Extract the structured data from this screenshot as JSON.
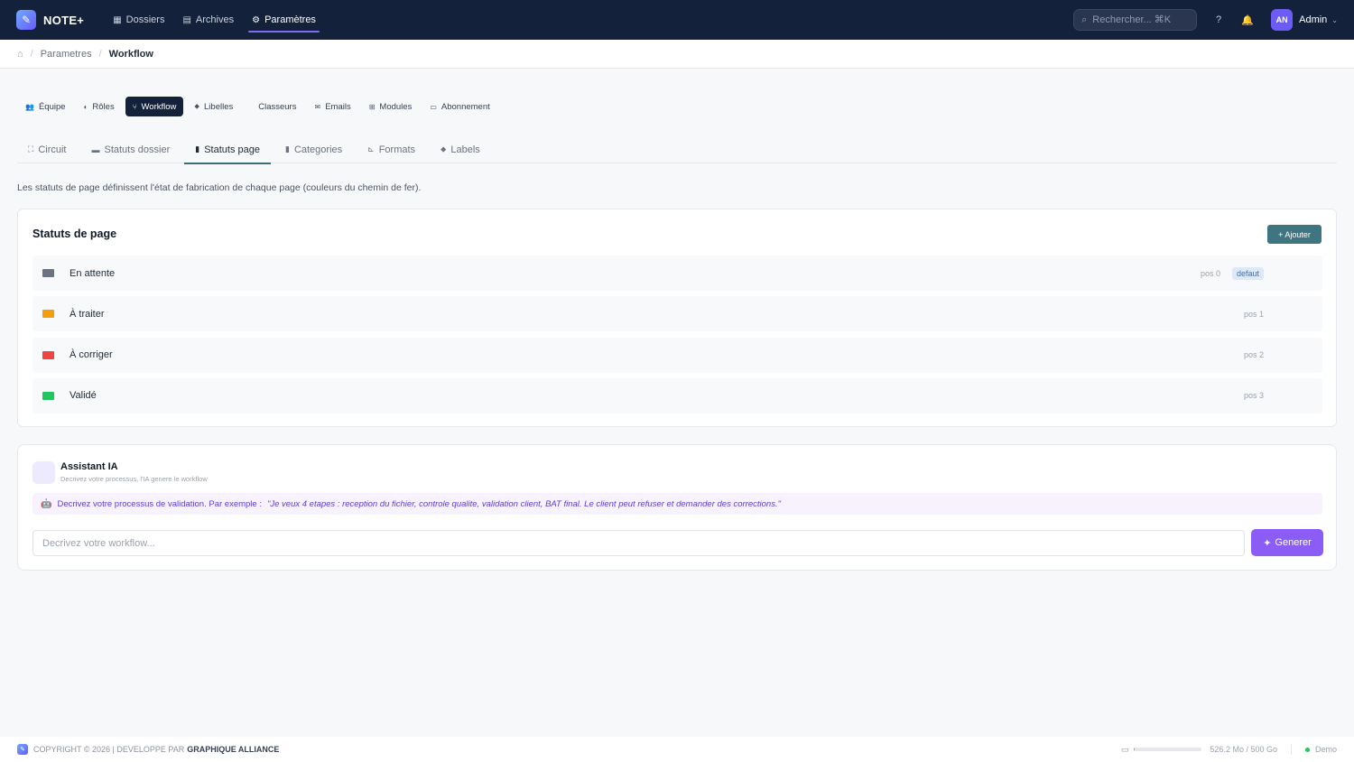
{
  "app": {
    "name": "NOTE+"
  },
  "nav": [
    {
      "label": "Dossiers",
      "icon": "grid-icon",
      "active": false
    },
    {
      "label": "Archives",
      "icon": "archive-icon",
      "active": false
    },
    {
      "label": "Paramètres",
      "icon": "gear-icon",
      "active": true
    }
  ],
  "search": {
    "placeholder": "Rechercher... ⌘K"
  },
  "user": {
    "initials": "AN",
    "name": "Admin"
  },
  "breadcrumb": {
    "parent": "Parametres",
    "current": "Workflow"
  },
  "settings_tabs": [
    {
      "label": "Équipe",
      "glyph": "👥"
    },
    {
      "label": "Rôles",
      "glyph": "◐"
    },
    {
      "label": "Workflow",
      "glyph": "⑂",
      "active": true
    },
    {
      "label": "Libelles",
      "glyph": "⬥"
    },
    {
      "label": "Classeurs",
      "glyph": ""
    },
    {
      "label": "Emails",
      "glyph": "✉"
    },
    {
      "label": "Modules",
      "glyph": "⊞"
    },
    {
      "label": "Abonnement",
      "glyph": "▭"
    }
  ],
  "sub_tabs": [
    {
      "label": "Circuit",
      "glyph": "⛶"
    },
    {
      "label": "Statuts dossier",
      "glyph": "▬"
    },
    {
      "label": "Statuts page",
      "glyph": "▮",
      "active": true
    },
    {
      "label": "Categories",
      "glyph": "▮"
    },
    {
      "label": "Formats",
      "glyph": "⊾"
    },
    {
      "label": "Labels",
      "glyph": "⬥"
    }
  ],
  "description": "Les statuts de page définissent l'état de fabrication de chaque page (couleurs du chemin de fer).",
  "statuses_card": {
    "title": "Statuts de page",
    "add_label": "+ Ajouter",
    "items": [
      {
        "name": "En attente",
        "color": "#6b7280",
        "pos": "pos 0",
        "badge": "defaut"
      },
      {
        "name": "À traiter",
        "color": "#f59e0b",
        "pos": "pos 1"
      },
      {
        "name": "À corriger",
        "color": "#ef4444",
        "pos": "pos 2"
      },
      {
        "name": "Validé",
        "color": "#22c55e",
        "pos": "pos 3"
      }
    ]
  },
  "assistant": {
    "title": "Assistant IA",
    "subtitle": "Decrivez votre processus, l'IA genere le workflow",
    "hint_prefix": "Decrivez votre processus de validation. Par exemple :",
    "hint_example": "\"Je veux 4 etapes : reception du fichier, controle qualite, validation client, BAT final. Le client peut refuser et demander des corrections.\"",
    "input_placeholder": "Decrivez votre workflow...",
    "generate_label": "Generer"
  },
  "footer": {
    "copyright": "COPYRIGHT © 2026 | DEVELOPPE PAR",
    "company": "GRAPHIQUE ALLIANCE",
    "storage_text": "526.2 Mo / 500 Go",
    "storage_fraction": 0.0011,
    "env": "Demo"
  },
  "colors": {
    "topbar": "#14213a",
    "accent": "#3f7581",
    "purple": "#8b5cf6"
  }
}
